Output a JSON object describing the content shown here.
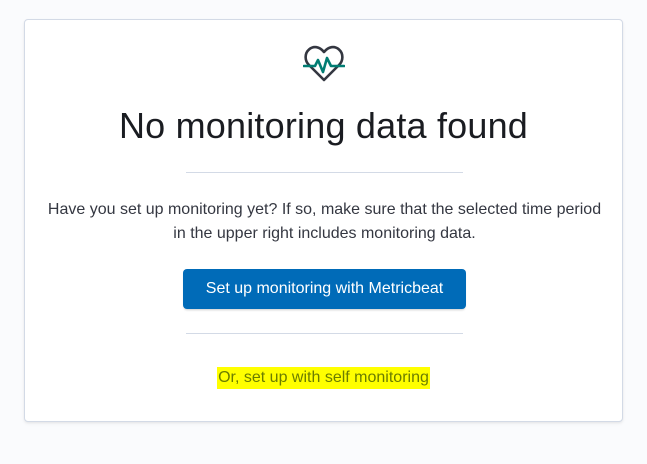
{
  "empty_state": {
    "icon": "heartbeat-icon",
    "title": "No monitoring data found",
    "description": "Have you set up monitoring yet? If so, make sure that the selected time period in the upper right includes monitoring data.",
    "primary_button_label": "Set up monitoring with Metricbeat",
    "secondary_link_label": "Or, set up with self monitoring"
  },
  "colors": {
    "primary": "#006bb8",
    "icon_line": "#017d73",
    "icon_outline": "#343741",
    "highlight": "#ffff00"
  }
}
